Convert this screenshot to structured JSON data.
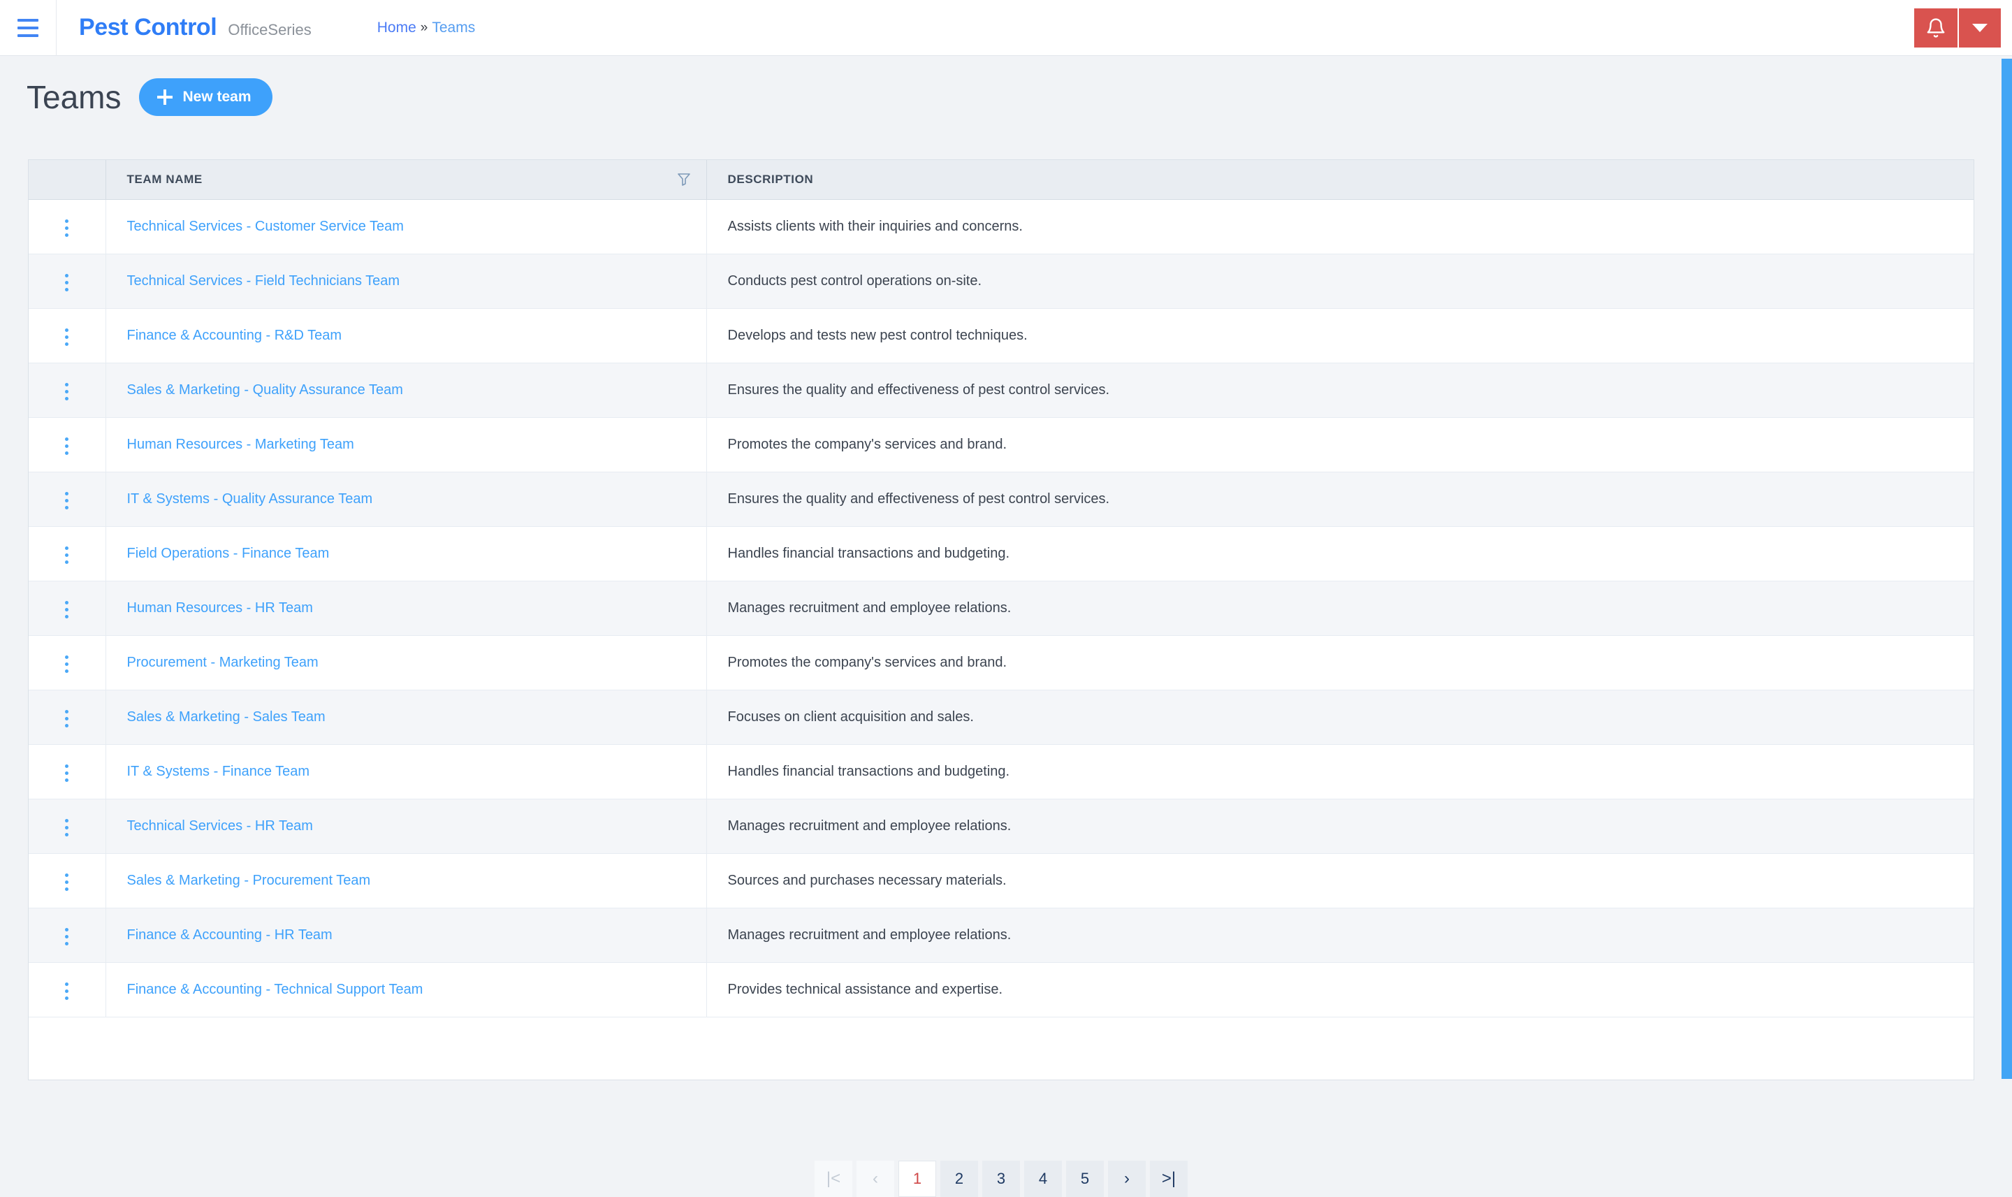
{
  "header": {
    "menu_icon": "hamburger-icon",
    "brand": "Pest Control",
    "brand_sub": "OfficeSeries",
    "breadcrumb": {
      "home": "Home",
      "separator": "»",
      "current": "Teams"
    },
    "notification_icon": "bell-icon",
    "notification_caret_icon": "chevron-down-icon",
    "accent_red": "#d9534f",
    "accent_blue": "#2f7df6"
  },
  "page": {
    "title": "Teams",
    "new_button_label": "New team",
    "new_button_icon": "plus-icon",
    "new_button_color": "#3ea1fb"
  },
  "table": {
    "columns": [
      "",
      "TEAM NAME",
      "DESCRIPTION"
    ],
    "filter_icon": "filter-funnel-icon",
    "row_menu_icon": "vertical-dots-icon",
    "rows": [
      {
        "name": "Technical Services - Customer Service Team",
        "description": "Assists clients with their inquiries and concerns."
      },
      {
        "name": "Technical Services - Field Technicians Team",
        "description": "Conducts pest control operations on-site."
      },
      {
        "name": "Finance & Accounting - R&D Team",
        "description": "Develops and tests new pest control techniques."
      },
      {
        "name": "Sales & Marketing - Quality Assurance Team",
        "description": "Ensures the quality and effectiveness of pest control services."
      },
      {
        "name": "Human Resources - Marketing Team",
        "description": "Promotes the company's services and brand."
      },
      {
        "name": "IT & Systems - Quality Assurance Team",
        "description": "Ensures the quality and effectiveness of pest control services."
      },
      {
        "name": "Field Operations - Finance Team",
        "description": "Handles financial transactions and budgeting."
      },
      {
        "name": "Human Resources - HR Team",
        "description": "Manages recruitment and employee relations."
      },
      {
        "name": "Procurement - Marketing Team",
        "description": "Promotes the company's services and brand."
      },
      {
        "name": "Sales & Marketing - Sales Team",
        "description": "Focuses on client acquisition and sales."
      },
      {
        "name": "IT & Systems - Finance Team",
        "description": "Handles financial transactions and budgeting."
      },
      {
        "name": "Technical Services - HR Team",
        "description": "Manages recruitment and employee relations."
      },
      {
        "name": "Sales & Marketing - Procurement Team",
        "description": "Sources and purchases necessary materials."
      },
      {
        "name": "Finance & Accounting - HR Team",
        "description": "Manages recruitment and employee relations."
      },
      {
        "name": "Finance & Accounting - Technical Support Team",
        "description": "Provides technical assistance and expertise."
      }
    ]
  },
  "pagination": {
    "first_label": "|<",
    "prev_label": "‹",
    "pages": [
      "1",
      "2",
      "3",
      "4",
      "5"
    ],
    "active_page": "1",
    "next_label": "›",
    "last_label": ">|",
    "active_color": "#cf4747"
  }
}
